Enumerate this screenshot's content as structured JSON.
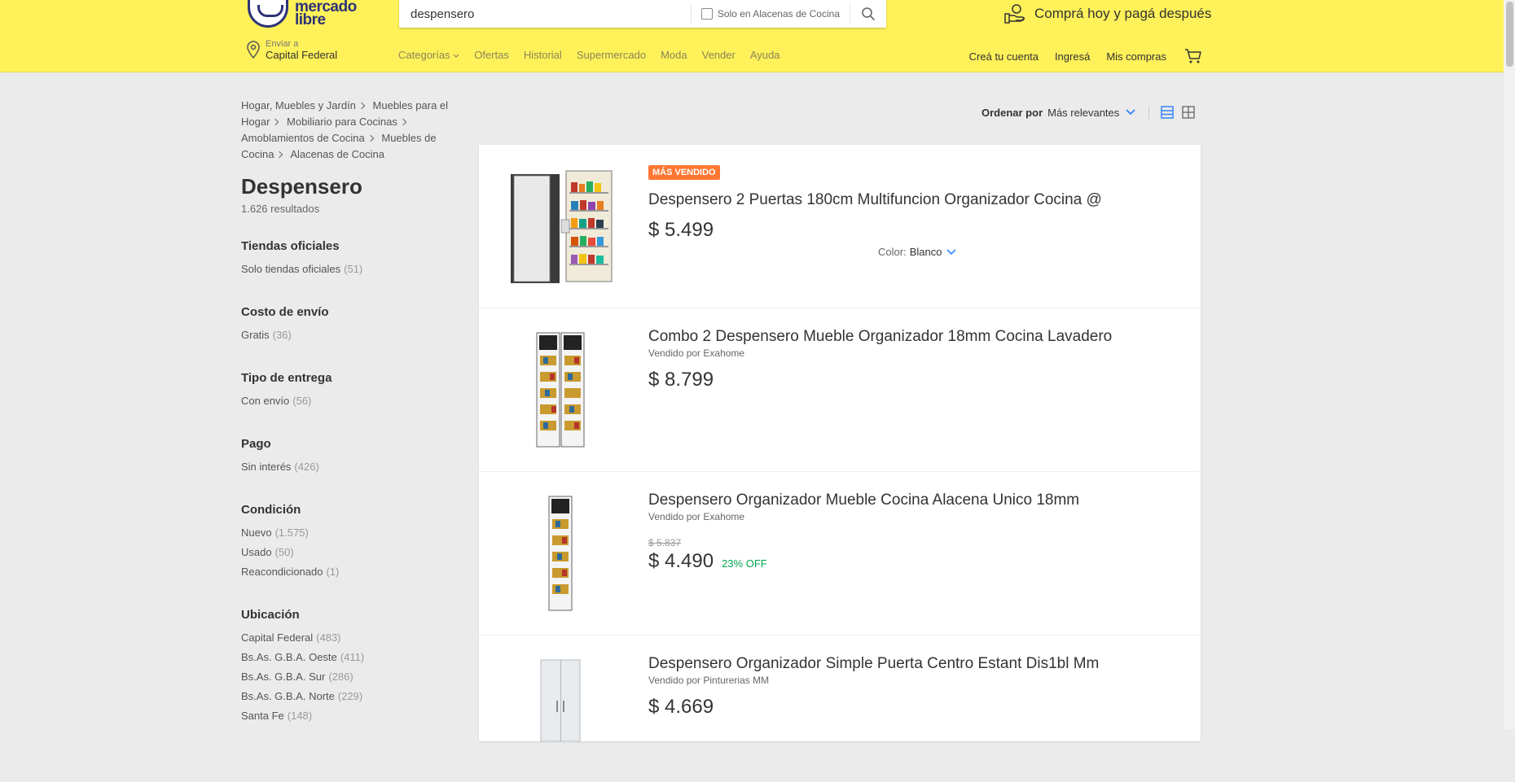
{
  "header": {
    "logo_line1": "mercado",
    "logo_line2": "libre",
    "search_value": "despensero",
    "search_filter_label": "Solo en Alacenas de Cocina",
    "promo_text": "Comprá hoy y pagá después",
    "location_small": "Enviar a",
    "location_big": "Capital Federal",
    "nav": [
      "Categorías",
      "Ofertas",
      "Historial",
      "Supermercado",
      "Moda",
      "Vender",
      "Ayuda"
    ],
    "user_nav": [
      "Creá tu cuenta",
      "Ingresá",
      "Mis compras"
    ],
    "accent_color": "#fff159",
    "brand_color": "#2d3277"
  },
  "breadcrumb": [
    "Hogar, Muebles y Jardín",
    "Muebles para el Hogar",
    "Mobiliario para Cocinas",
    "Amoblamientos de Cocina",
    "Muebles de Cocina",
    "Alacenas de Cocina"
  ],
  "page": {
    "title": "Despensero",
    "results": "1.626 resultados"
  },
  "filters": [
    {
      "title": "Tiendas oficiales",
      "options": [
        {
          "label": "Solo tiendas oficiales",
          "count": "(51)"
        }
      ]
    },
    {
      "title": "Costo de envío",
      "options": [
        {
          "label": "Gratis",
          "count": "(36)"
        }
      ]
    },
    {
      "title": "Tipo de entrega",
      "options": [
        {
          "label": "Con envío",
          "count": "(56)"
        }
      ]
    },
    {
      "title": "Pago",
      "options": [
        {
          "label": "Sin interés",
          "count": "(426)"
        }
      ]
    },
    {
      "title": "Condición",
      "options": [
        {
          "label": "Nuevo",
          "count": "(1.575)"
        },
        {
          "label": "Usado",
          "count": "(50)"
        },
        {
          "label": "Reacondicionado",
          "count": "(1)"
        }
      ]
    },
    {
      "title": "Ubicación",
      "options": [
        {
          "label": "Capital Federal",
          "count": "(483)"
        },
        {
          "label": "Bs.As. G.B.A. Oeste",
          "count": "(411)"
        },
        {
          "label": "Bs.As. G.B.A. Sur",
          "count": "(286)"
        },
        {
          "label": "Bs.As. G.B.A. Norte",
          "count": "(229)"
        },
        {
          "label": "Santa Fe",
          "count": "(148)"
        }
      ]
    }
  ],
  "sort": {
    "label": "Ordenar por",
    "value": "Más relevantes"
  },
  "items": [
    {
      "badge": "MÁS VENDIDO",
      "title": "Despensero 2 Puertas 180cm Multifuncion Organizador Cocina @",
      "seller": "",
      "old_price": "",
      "price": "$ 5.499",
      "discount": "",
      "variation_label": "Color:",
      "variation_value": "Blanco"
    },
    {
      "badge": "",
      "title": "Combo 2 Despensero Mueble Organizador 18mm Cocina Lavadero",
      "seller": "Vendido por Exahome",
      "old_price": "",
      "price": "$ 8.799",
      "discount": ""
    },
    {
      "badge": "",
      "title": "Despensero Organizador Mueble Cocina Alacena Unico 18mm",
      "seller": "Vendido por Exahome",
      "old_price": "$ 5.837",
      "price": "$ 4.490",
      "discount": "23% OFF"
    },
    {
      "badge": "",
      "title": "Despensero Organizador Simple Puerta Centro Estant Dis1bl Mm",
      "seller": "Vendido por Pinturerias MM",
      "old_price": "",
      "price": "$ 4.669",
      "discount": ""
    }
  ],
  "icons": {
    "search": "search-icon",
    "location": "location-pin-icon",
    "cart": "cart-icon",
    "promo": "hand-coin-icon",
    "list_view": "list-view-icon",
    "grid_view": "grid-view-icon"
  },
  "colors": {
    "badge": "#ff7733",
    "discount": "#00a650",
    "link_blue": "#3483fa"
  }
}
